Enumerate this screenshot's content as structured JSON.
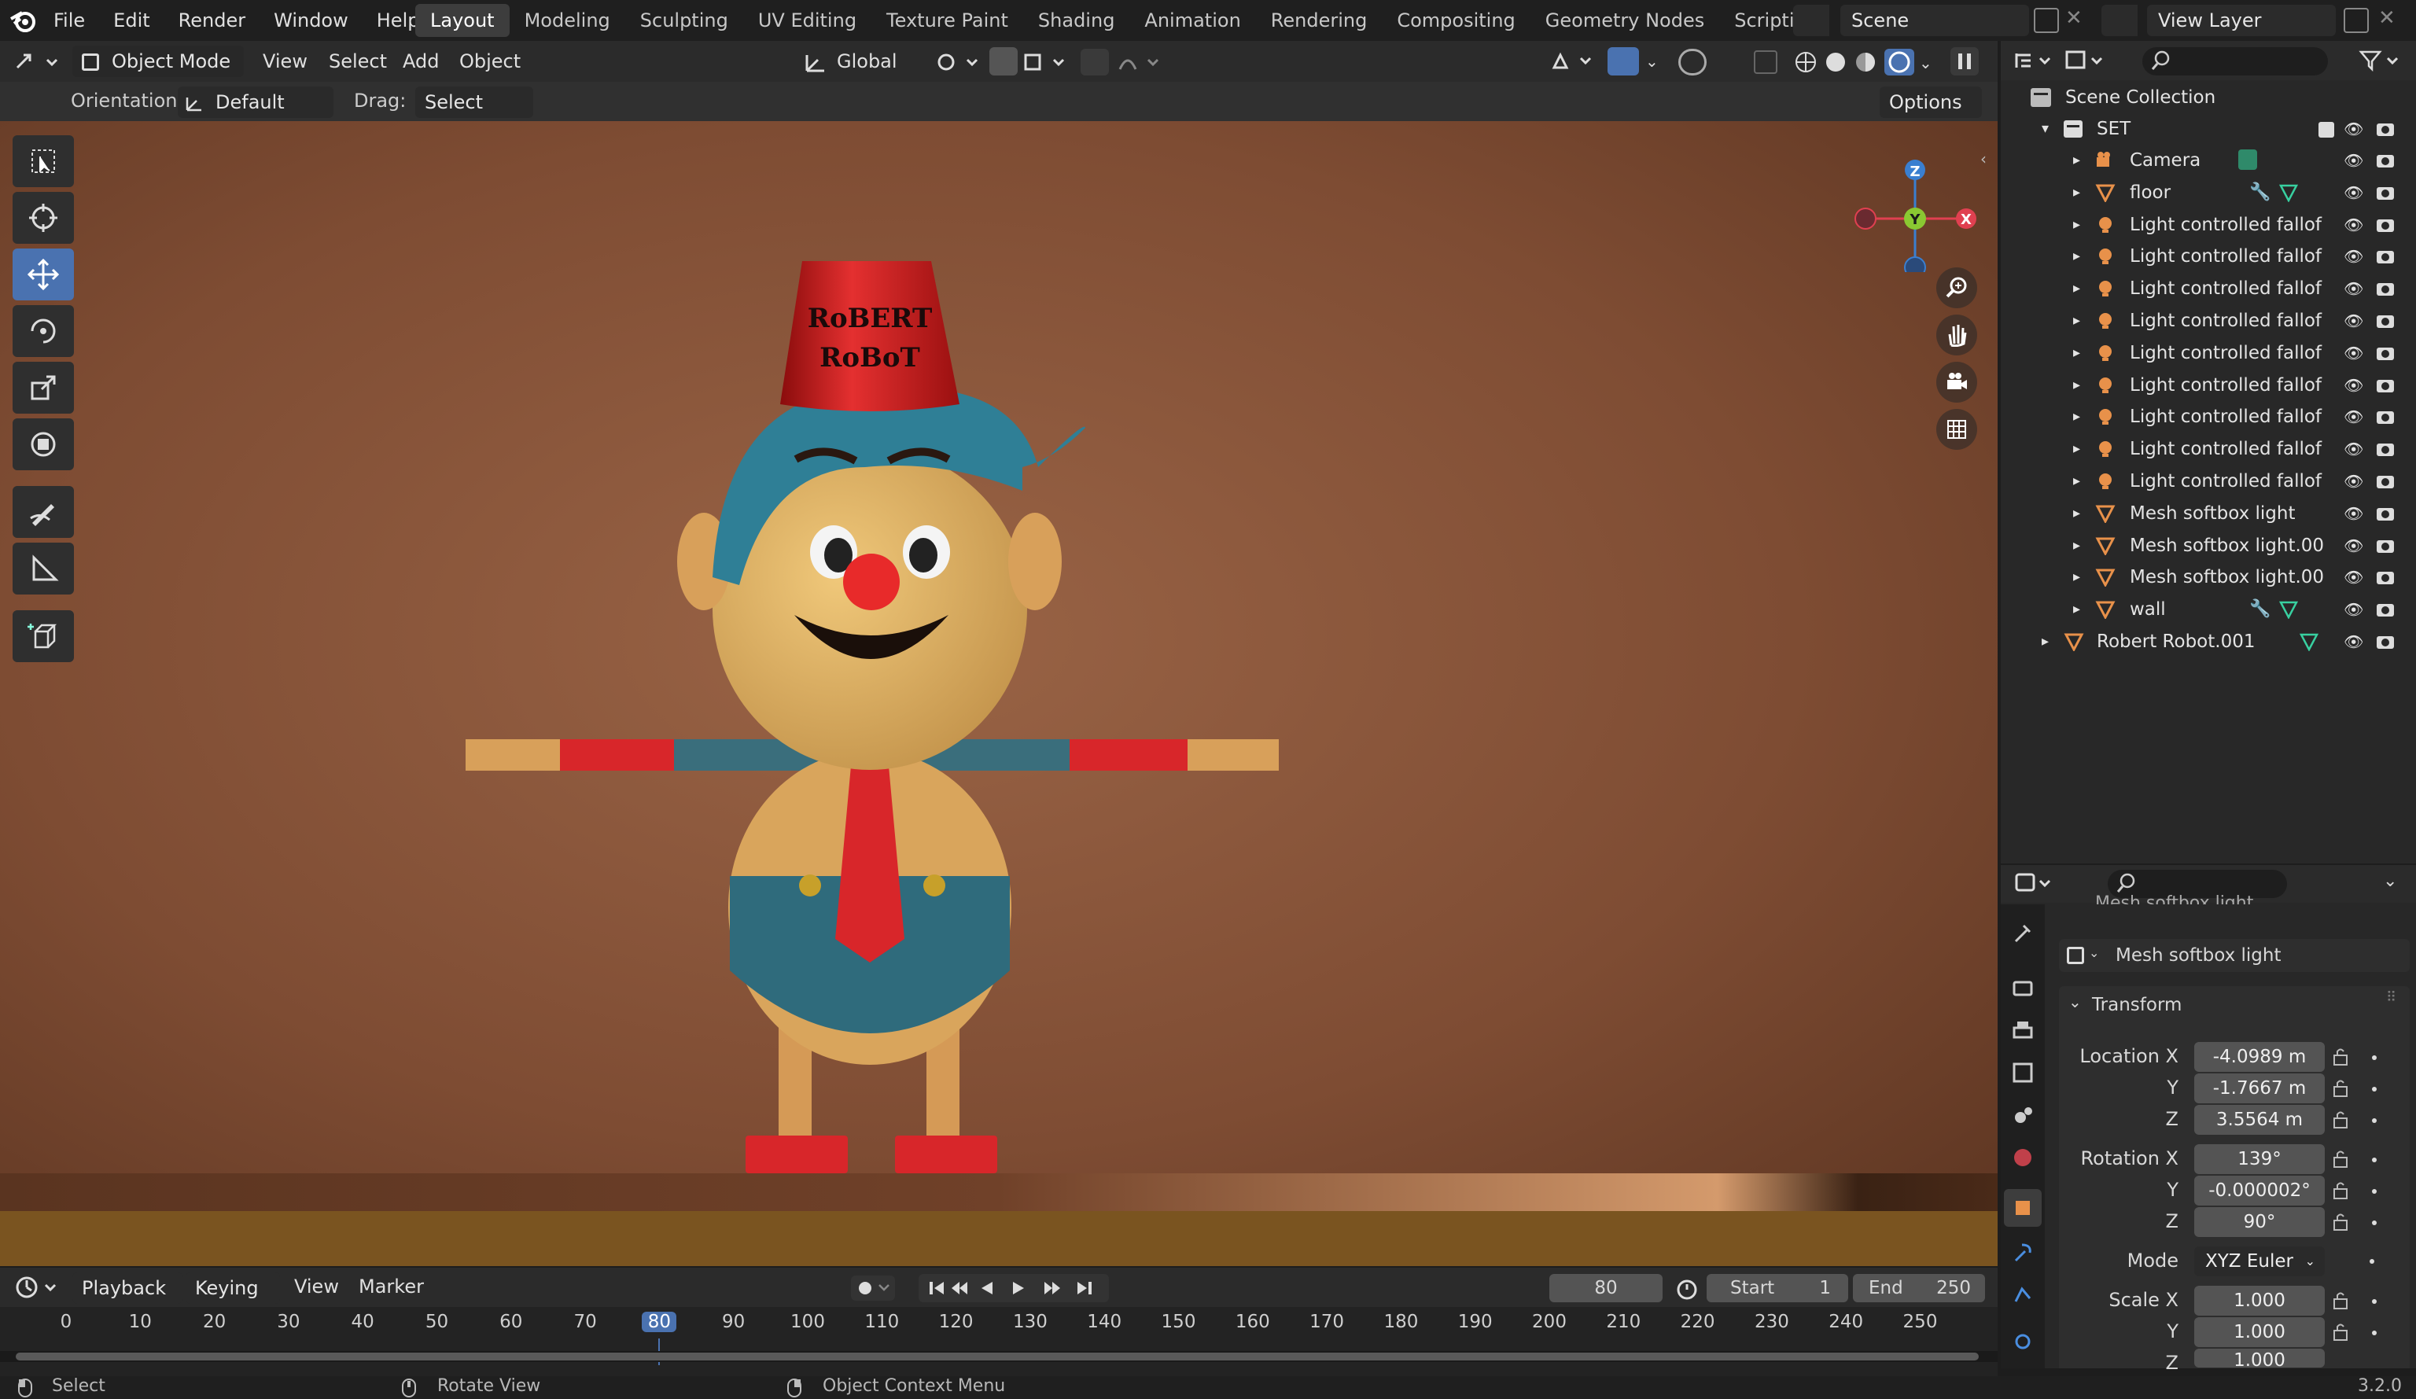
{
  "menu": [
    "File",
    "Edit",
    "Render",
    "Window",
    "Help"
  ],
  "workspaces": [
    "Layout",
    "Modeling",
    "Sculpting",
    "UV Editing",
    "Texture Paint",
    "Shading",
    "Animation",
    "Rendering",
    "Compositing",
    "Geometry Nodes",
    "Scripting"
  ],
  "workspaces_active": "Layout",
  "scene_name": "Scene",
  "view_layer": "View Layer",
  "header": {
    "mode": "Object Mode",
    "view": "View",
    "select": "Select",
    "add": "Add",
    "object": "Object",
    "transform_orientation": "Global"
  },
  "tool_settings": {
    "orientation_label": "Orientation:",
    "orientation_value": "Default",
    "drag_label": "Drag:",
    "drag_value": "Select Box",
    "options": "Options"
  },
  "viewport": {
    "hat_text_line1": "RoBERT",
    "hat_text_line2": "RoBoT",
    "gizmo": {
      "z": "Z",
      "y": "Y",
      "x": "X"
    }
  },
  "outliner": {
    "root": "Scene Collection",
    "set": "SET",
    "items": [
      {
        "name": "Camera",
        "type": "camera"
      },
      {
        "name": "floor",
        "type": "mesh"
      },
      {
        "name": "Light controlled fallof",
        "type": "light"
      },
      {
        "name": "Light controlled fallof",
        "type": "light"
      },
      {
        "name": "Light controlled fallof",
        "type": "light"
      },
      {
        "name": "Light controlled fallof",
        "type": "light"
      },
      {
        "name": "Light controlled fallof",
        "type": "light"
      },
      {
        "name": "Light controlled fallof",
        "type": "light"
      },
      {
        "name": "Light controlled fallof",
        "type": "light"
      },
      {
        "name": "Light controlled fallof",
        "type": "light"
      },
      {
        "name": "Light controlled fallof",
        "type": "light"
      },
      {
        "name": "Mesh softbox light",
        "type": "mesh"
      },
      {
        "name": "Mesh softbox light.00",
        "type": "mesh"
      },
      {
        "name": "Mesh softbox light.00",
        "type": "mesh"
      },
      {
        "name": "wall",
        "type": "mesh"
      }
    ],
    "extra": "Robert Robot.001"
  },
  "properties": {
    "partial_title": "Mesh softbox light",
    "object_name": "Mesh softbox light",
    "panel": "Transform",
    "location_label": "Location X",
    "loc": [
      "-4.0989 m",
      "-1.7667 m",
      "3.5564 m"
    ],
    "rotation_label": "Rotation X",
    "rot": [
      "139°",
      "-0.000002°",
      "90°"
    ],
    "mode_label": "Mode",
    "mode_value": "XYZ Euler",
    "scale_label": "Scale X",
    "scale": [
      "1.000",
      "1.000",
      "1.000"
    ],
    "y": "Y",
    "z": "Z"
  },
  "timeline": {
    "playback": "Playback",
    "keying": "Keying",
    "view": "View",
    "marker": "Marker",
    "current_frame": "80",
    "start_label": "Start",
    "start": "1",
    "end_label": "End",
    "end": "250",
    "ticks": [
      "0",
      "10",
      "20",
      "30",
      "40",
      "50",
      "60",
      "70",
      "80",
      "90",
      "100",
      "110",
      "120",
      "130",
      "140",
      "150",
      "160",
      "170",
      "180",
      "190",
      "200",
      "210",
      "220",
      "230",
      "240",
      "250"
    ]
  },
  "status": {
    "select": "Select",
    "rotate": "Rotate View",
    "context": "Object Context Menu",
    "version": "3.2.0"
  }
}
